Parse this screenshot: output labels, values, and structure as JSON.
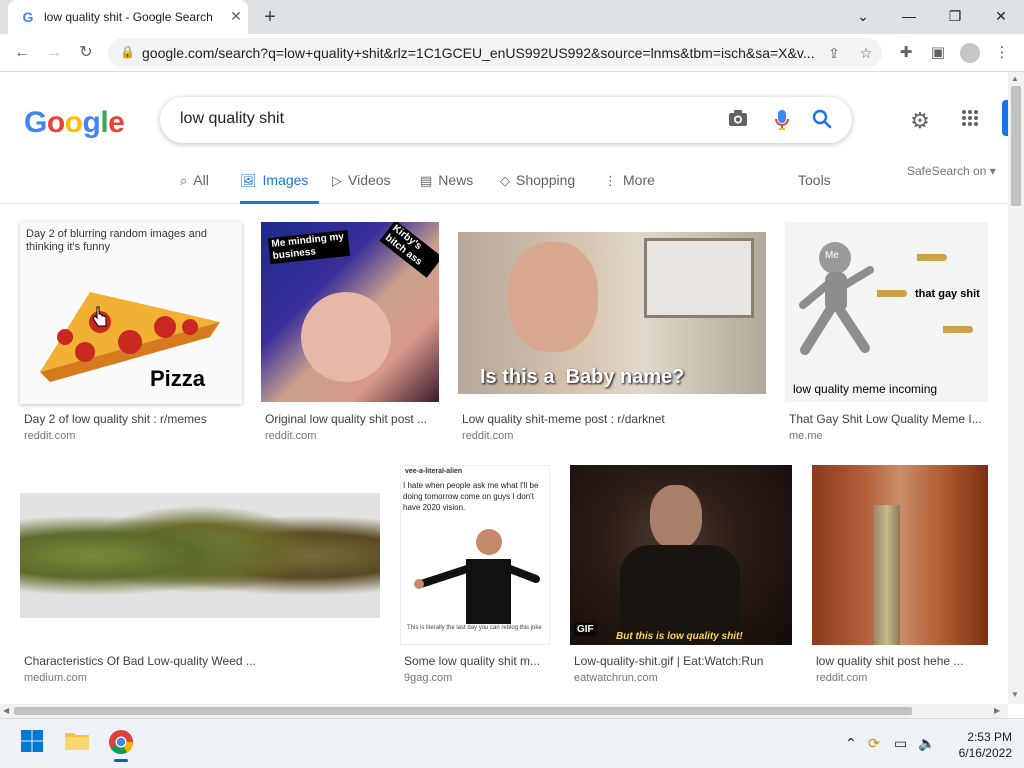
{
  "browser": {
    "tab_title": "low quality shit - Google Search",
    "favicon": "G",
    "url": "google.com/search?q=low+quality+shit&rlz=1C1GCEU_enUS992US992&source=lnms&tbm=isch&sa=X&v..."
  },
  "search": {
    "logo_letters": [
      "G",
      "o",
      "o",
      "g",
      "l",
      "e"
    ],
    "logo_colors": [
      "#4285f4",
      "#ea4335",
      "#fbbc05",
      "#4285f4",
      "#34a853",
      "#ea4335"
    ],
    "query": "low quality shit",
    "tabs": [
      {
        "label": "All",
        "icon": "search-icon"
      },
      {
        "label": "Images",
        "icon": "image-icon",
        "active": true
      },
      {
        "label": "Videos",
        "icon": "play-icon"
      },
      {
        "label": "News",
        "icon": "news-icon"
      },
      {
        "label": "Shopping",
        "icon": "tag-icon"
      },
      {
        "label": "More",
        "icon": "more-vert-icon"
      }
    ],
    "tools_label": "Tools",
    "safesearch_label": "SafeSearch on"
  },
  "results": [
    {
      "title": "Day 2 of low quality shit : r/memes",
      "source": "reddit.com",
      "overlay_top": "Day 2 of blurring random images and thinking it's funny",
      "overlay_bottom": "Pizza"
    },
    {
      "title": "Original low quality shit post ...",
      "source": "reddit.com",
      "overlay_left": "Me minding my business",
      "overlay_right": "Kirby's bitch ass"
    },
    {
      "title": "Low quality shit-meme post : r/darknet",
      "source": "reddit.com",
      "overlay_bottom": "Is this a  Baby name?"
    },
    {
      "title": "That Gay Shit Low Quality Meme I...",
      "source": "me.me",
      "overlay_me": "Me",
      "overlay_right": "that gay shit",
      "overlay_bottom": "low quality meme incoming"
    },
    {
      "title": "Characteristics Of Bad Low-quality Weed ...",
      "source": "medium.com"
    },
    {
      "title": "Some low quality shit m...",
      "source": "9gag.com",
      "overlay_user": "vee-a-literal-alien",
      "overlay_top": "I hate when people ask me what I'll be doing  tomorrow come on guys I don't have 2020 vision.",
      "overlay_bottom": "This is literally the last  day you can reblog this joke"
    },
    {
      "title": "Low-quality-shit.gif | Eat:Watch:Run",
      "source": "eatwatchrun.com",
      "overlay_badge": "GIF",
      "overlay_bottom": "But this is low quality shit!"
    },
    {
      "title": "low quality shit post hehe ...",
      "source": "reddit.com"
    }
  ],
  "taskbar": {
    "time": "2:53 PM",
    "date": "6/16/2022"
  }
}
